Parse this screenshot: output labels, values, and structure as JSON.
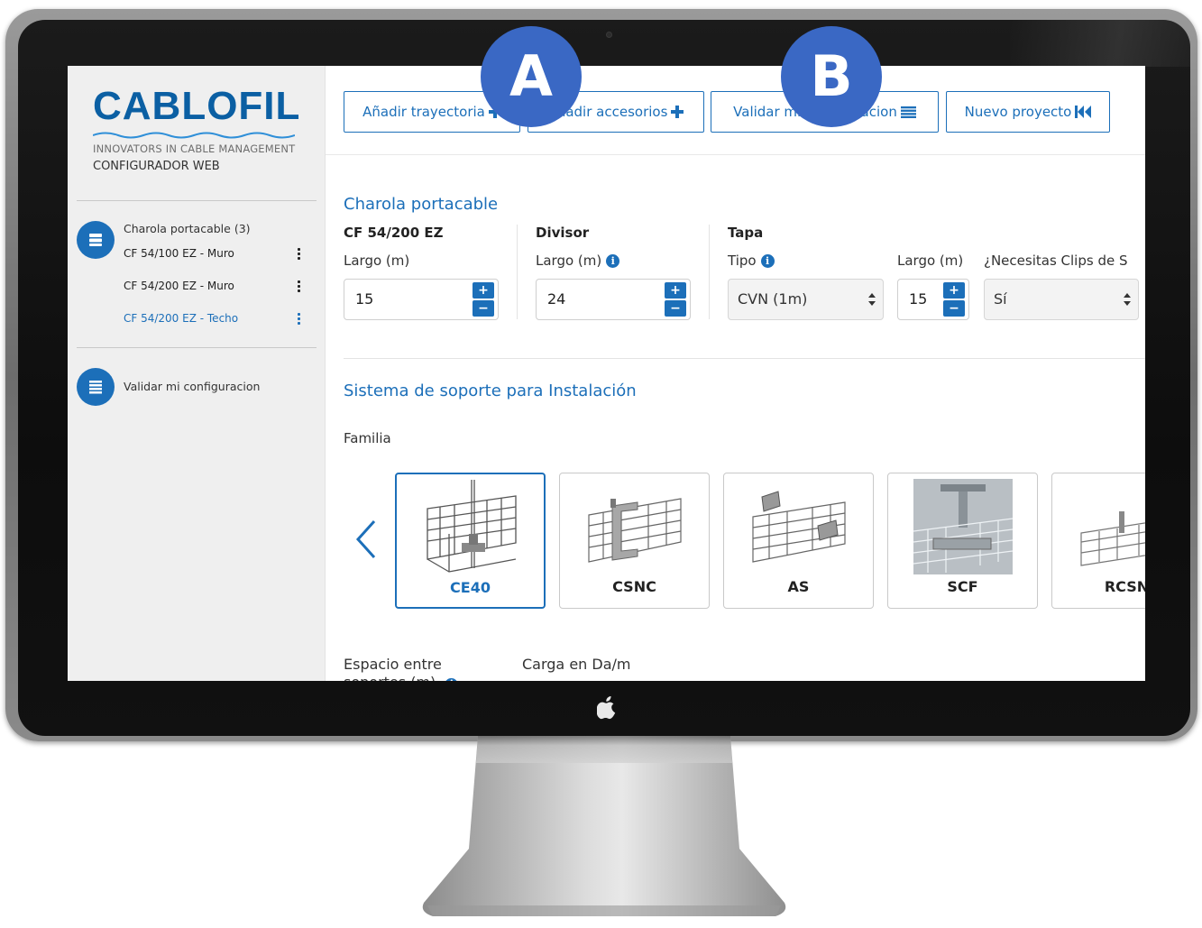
{
  "brand": {
    "logo": "CABLOFIL",
    "tagline": "INNOVATORS IN CABLE MANAGEMENT",
    "subtitle": "CONFIGURADOR WEB"
  },
  "sidebar": {
    "group_title": "Charola portacable (3)",
    "items": [
      {
        "label": "CF 54/100 EZ - Muro",
        "active": false
      },
      {
        "label": "CF 54/200 EZ - Muro",
        "active": false
      },
      {
        "label": "CF 54/200 EZ - Techo",
        "active": true
      }
    ],
    "validate_label": "Validar mi configuracion"
  },
  "toolbar": {
    "add_path": "Añadir trayectoria",
    "add_accessories": "Añadir accesorios",
    "validate": "Validar mi configuracion",
    "new_project": "Nuevo proyecto"
  },
  "tray": {
    "section_title": "Charola portacable",
    "product": "CF 54/200 EZ",
    "length_label": "Largo (m)",
    "length_value": "15",
    "divider_head": "Divisor",
    "divider_length_label": "Largo (m)",
    "divider_length_value": "24",
    "lid_head": "Tapa",
    "lid_type_label": "Tipo",
    "lid_type_value": "CVN (1m)",
    "lid_length_label": "Largo (m)",
    "lid_length_value": "15",
    "clips_label": "¿Necesitas Clips de S",
    "clips_value": "Sí"
  },
  "support": {
    "section_title": "Sistema de soporte para Instalación",
    "family_label": "Familia",
    "families": [
      {
        "label": "CE40",
        "selected": true
      },
      {
        "label": "CSNC",
        "selected": false
      },
      {
        "label": "AS",
        "selected": false
      },
      {
        "label": "SCF",
        "selected": false
      },
      {
        "label": "RCSN",
        "selected": false
      }
    ],
    "spacing_label": "Espacio entre soportes (m)",
    "load_label": "Carga en Da/m"
  },
  "badges": {
    "a": "A",
    "b": "B"
  },
  "colors": {
    "accent": "#1c6fb9",
    "badge": "#3a68c4",
    "sidebar_bg": "#efefef"
  },
  "icons": [
    "plus-icon",
    "list-icon",
    "rewind-icon",
    "info-icon",
    "chevron-left-icon",
    "apple-icon"
  ]
}
